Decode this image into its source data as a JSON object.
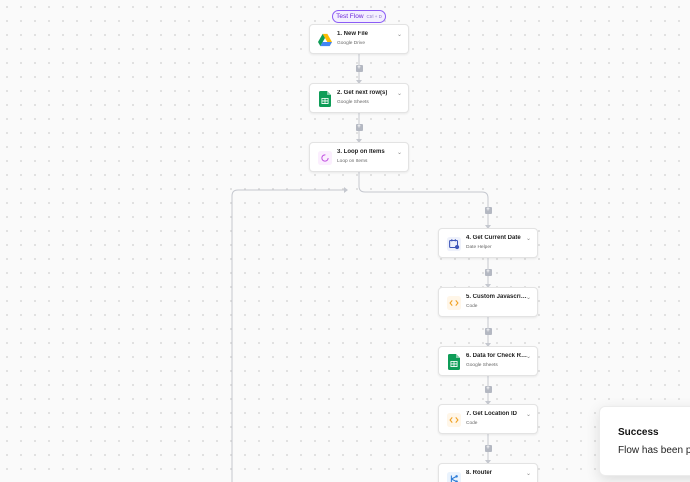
{
  "test_flow": {
    "label": "Test Flow",
    "shortcut": "Ctrl + D"
  },
  "steps": [
    {
      "title": "1. New File",
      "subtitle": "Google Drive",
      "icon": "google-drive-icon"
    },
    {
      "title": "2. Get next row(s)",
      "subtitle": "Google Sheets",
      "icon": "google-sheets-icon"
    },
    {
      "title": "3. Loop on Items",
      "subtitle": "Loop on Items",
      "icon": "loop-icon"
    },
    {
      "title": "4. Get Current Date",
      "subtitle": "Date Helper",
      "icon": "date-helper-icon"
    },
    {
      "title": "5. Custom Javascript ...",
      "subtitle": "Code",
      "icon": "code-icon"
    },
    {
      "title": "6. Data for Check Row ...",
      "subtitle": "Google Sheets",
      "icon": "google-sheets-icon"
    },
    {
      "title": "7. Get Location ID",
      "subtitle": "Code",
      "icon": "code-icon"
    },
    {
      "title": "8. Router",
      "subtitle": "",
      "icon": "router-icon"
    }
  ],
  "toast": {
    "title": "Success",
    "message": "Flow has been p"
  },
  "colors": {
    "accent": "#8b5cf6",
    "connector": "#c5c8cf",
    "plus": "#b4b8c2"
  }
}
